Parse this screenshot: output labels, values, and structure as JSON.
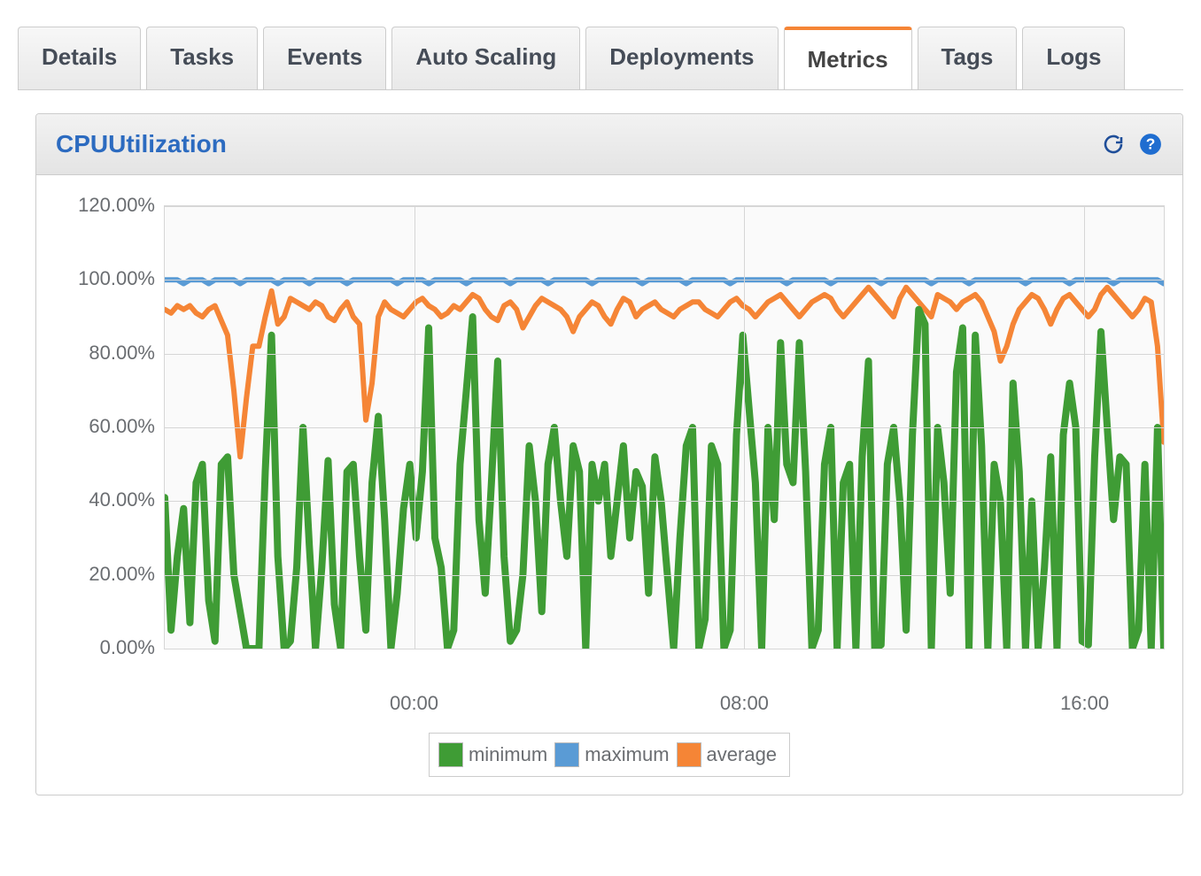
{
  "tabs": [
    "Details",
    "Tasks",
    "Events",
    "Auto Scaling",
    "Deployments",
    "Metrics",
    "Tags",
    "Logs"
  ],
  "active_tab": "Metrics",
  "panel": {
    "title": "CPUUtilization"
  },
  "colors": {
    "min": "#3f9c35",
    "max": "#5a9bd5",
    "avg": "#f58536"
  },
  "legend": [
    {
      "key": "min",
      "label": "minimum"
    },
    {
      "key": "max",
      "label": "maximum"
    },
    {
      "key": "avg",
      "label": "average"
    }
  ],
  "chart_data": {
    "type": "line",
    "title": "CPUUtilization",
    "xlabel": "",
    "ylabel": "",
    "ylim": [
      0,
      120
    ],
    "y_ticks": [
      0,
      20,
      40,
      60,
      80,
      100,
      120
    ],
    "y_tick_labels": [
      "0.00%",
      "20.00%",
      "40.00%",
      "60.00%",
      "80.00%",
      "100.00%",
      "120.00%"
    ],
    "x_major": [
      "00:00",
      "08:00",
      "16:00"
    ],
    "x_major_pos": [
      0.25,
      0.58,
      0.92
    ],
    "n_points": 160,
    "series": [
      {
        "name": "maximum",
        "color": "max",
        "values": [
          100,
          100,
          100,
          99,
          100,
          100,
          100,
          99,
          100,
          100,
          100,
          100,
          99,
          100,
          100,
          100,
          100,
          100,
          99,
          100,
          100,
          100,
          100,
          99,
          100,
          100,
          100,
          100,
          100,
          99,
          100,
          100,
          100,
          100,
          100,
          100,
          100,
          99,
          100,
          100,
          100,
          100,
          99,
          100,
          100,
          100,
          100,
          100,
          99,
          100,
          100,
          100,
          100,
          100,
          100,
          99,
          100,
          100,
          100,
          100,
          100,
          99,
          100,
          100,
          100,
          100,
          100,
          100,
          99,
          100,
          100,
          100,
          100,
          100,
          100,
          100,
          99,
          100,
          100,
          100,
          100,
          100,
          100,
          99,
          100,
          100,
          100,
          100,
          100,
          100,
          99,
          100,
          100,
          100,
          100,
          100,
          100,
          100,
          100,
          99,
          100,
          100,
          100,
          100,
          100,
          100,
          99,
          100,
          100,
          100,
          100,
          100,
          100,
          100,
          99,
          100,
          100,
          100,
          100,
          100,
          100,
          100,
          99,
          100,
          100,
          100,
          100,
          100,
          99,
          100,
          100,
          100,
          100,
          100,
          100,
          100,
          100,
          99,
          100,
          100,
          100,
          100,
          100,
          100,
          99,
          100,
          100,
          100,
          100,
          100,
          100,
          99,
          100,
          100,
          100,
          100,
          100,
          100,
          100,
          99
        ]
      },
      {
        "name": "average",
        "color": "avg",
        "values": [
          92,
          91,
          93,
          92,
          93,
          91,
          90,
          92,
          93,
          89,
          85,
          70,
          52,
          68,
          82,
          82,
          90,
          97,
          88,
          90,
          95,
          94,
          93,
          92,
          94,
          93,
          90,
          89,
          92,
          94,
          90,
          88,
          62,
          72,
          90,
          94,
          92,
          91,
          90,
          92,
          94,
          95,
          93,
          92,
          90,
          91,
          93,
          92,
          94,
          96,
          95,
          92,
          90,
          89,
          93,
          94,
          92,
          87,
          90,
          93,
          95,
          94,
          93,
          92,
          90,
          86,
          90,
          92,
          94,
          93,
          90,
          88,
          92,
          95,
          94,
          90,
          92,
          93,
          94,
          92,
          91,
          90,
          92,
          93,
          94,
          94,
          92,
          91,
          90,
          92,
          94,
          95,
          93,
          92,
          90,
          92,
          94,
          95,
          96,
          94,
          92,
          90,
          92,
          94,
          95,
          96,
          95,
          92,
          90,
          92,
          94,
          96,
          98,
          96,
          94,
          92,
          90,
          95,
          98,
          96,
          94,
          92,
          90,
          96,
          95,
          94,
          92,
          94,
          95,
          96,
          94,
          90,
          86,
          78,
          82,
          88,
          92,
          94,
          96,
          95,
          92,
          88,
          92,
          95,
          96,
          94,
          92,
          90,
          92,
          96,
          98,
          96,
          94,
          92,
          90,
          92,
          95,
          94,
          82,
          56
        ]
      },
      {
        "name": "minimum",
        "color": "min",
        "values": [
          41,
          5,
          25,
          38,
          7,
          45,
          50,
          13,
          2,
          50,
          52,
          20,
          10,
          0,
          0,
          0,
          48,
          85,
          25,
          0,
          2,
          22,
          60,
          28,
          0,
          22,
          51,
          12,
          0,
          48,
          50,
          25,
          5,
          45,
          63,
          35,
          0,
          15,
          38,
          50,
          30,
          48,
          87,
          30,
          22,
          0,
          5,
          50,
          70,
          90,
          35,
          15,
          45,
          78,
          25,
          2,
          5,
          20,
          55,
          40,
          10,
          50,
          60,
          40,
          25,
          55,
          48,
          0,
          50,
          40,
          50,
          25,
          40,
          55,
          30,
          48,
          44,
          15,
          52,
          40,
          20,
          0,
          30,
          55,
          60,
          0,
          8,
          55,
          50,
          0,
          5,
          58,
          85,
          65,
          45,
          0,
          60,
          35,
          83,
          50,
          45,
          83,
          48,
          0,
          5,
          50,
          60,
          0,
          45,
          50,
          0,
          52,
          78,
          0,
          1,
          50,
          60,
          40,
          5,
          58,
          92,
          88,
          0,
          60,
          45,
          15,
          75,
          87,
          0,
          85,
          55,
          0,
          50,
          40,
          0,
          72,
          48,
          0,
          40,
          0,
          22,
          52,
          0,
          58,
          72,
          60,
          2,
          1,
          52,
          86,
          60,
          35,
          52,
          50,
          0,
          5,
          50,
          0,
          60,
          0
        ]
      }
    ]
  }
}
